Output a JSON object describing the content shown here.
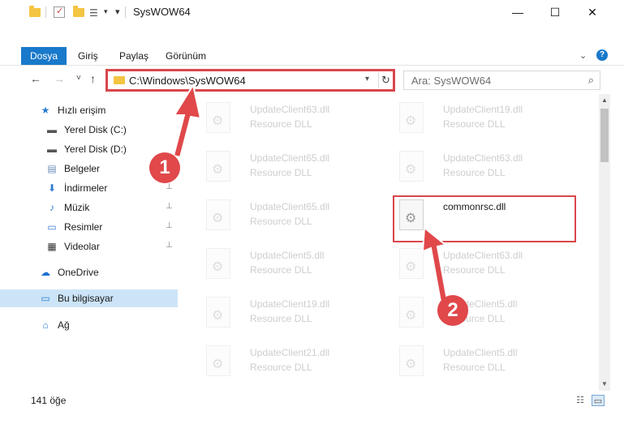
{
  "window": {
    "title": "SysWOW64",
    "controls": {
      "minimize": "—",
      "maximize": "☐",
      "close": "✕"
    }
  },
  "ribbon": {
    "tabs": [
      "Dosya",
      "Giriş",
      "Paylaş",
      "Görünüm"
    ],
    "collapse_icon": "chevron-up-icon",
    "help": "?"
  },
  "nav": {
    "back": "←",
    "forward": "→",
    "recent": "˅",
    "up": "↑",
    "address": "C:\\Windows\\SysWOW64",
    "refresh": "↻",
    "search_placeholder": "Ara: SysWOW64"
  },
  "sidebar": {
    "items": [
      {
        "label": "Hızlı erişim",
        "icon": "star-icon",
        "glyph": "★",
        "color": "#2b7cd3",
        "level": 0
      },
      {
        "label": "Yerel Disk (C:)",
        "icon": "drive-icon",
        "glyph": "▬",
        "color": "#555555",
        "level": 1,
        "pinned": true
      },
      {
        "label": "Yerel Disk (D:)",
        "icon": "drive-icon",
        "glyph": "▬",
        "color": "#555555",
        "level": 1,
        "pinned": true
      },
      {
        "label": "Belgeler",
        "icon": "documents-icon",
        "glyph": "▤",
        "color": "#6b8fb8",
        "level": 1,
        "pinned": true
      },
      {
        "label": "İndirmeler",
        "icon": "downloads-icon",
        "glyph": "⬇",
        "color": "#2b7cd3",
        "level": 1,
        "pinned": true
      },
      {
        "label": "Müzik",
        "icon": "music-icon",
        "glyph": "♪",
        "color": "#2b7cd3",
        "level": 1,
        "pinned": true
      },
      {
        "label": "Resimler",
        "icon": "pictures-icon",
        "glyph": "▭",
        "color": "#3a7bd5",
        "level": 1,
        "pinned": true
      },
      {
        "label": "Videolar",
        "icon": "videos-icon",
        "glyph": "▦",
        "color": "#333333",
        "level": 1,
        "pinned": true
      },
      {
        "label": "OneDrive",
        "icon": "cloud-icon",
        "glyph": "☁",
        "color": "#1e6fcf",
        "level": 0
      },
      {
        "label": "Bu bilgisayar",
        "icon": "computer-icon",
        "glyph": "▭",
        "color": "#2b7cd3",
        "level": 0,
        "selected": true
      },
      {
        "label": "Ağ",
        "icon": "network-icon",
        "glyph": "⌂",
        "color": "#2b7cd3",
        "level": 0
      }
    ],
    "pin_glyph": "📌"
  },
  "files": [
    {
      "name": "UpdateClient63.dll",
      "type": "Resource DLL",
      "faded": true
    },
    {
      "name": "UpdateClient19.dll",
      "type": "Resource DLL",
      "faded": true
    },
    {
      "name": "UpdateClient65.dll",
      "type": "Resource DLL",
      "faded": true
    },
    {
      "name": "UpdateClient63.dll",
      "type": "Resource DLL",
      "faded": true
    },
    {
      "name": "UpdateClient65.dll",
      "type": "Resource DLL",
      "faded": true
    },
    {
      "name": "commonrsc.dll",
      "type": "",
      "faded": false,
      "highlighted": true
    },
    {
      "name": "UpdateClient5.dll",
      "type": "Resource DLL",
      "faded": true
    },
    {
      "name": "UpdateClient63.dll",
      "type": "Resource DLL",
      "faded": true
    },
    {
      "name": "UpdateClient19.dll",
      "type": "Resource DLL",
      "faded": true
    },
    {
      "name": "UpdateClient5.dll",
      "type": "Resource DLL",
      "faded": true
    },
    {
      "name": "UpdateClient21.dll",
      "type": "Resource DLL",
      "faded": true
    },
    {
      "name": "UpdateClient5.dll",
      "type": "Resource DLL",
      "faded": true
    }
  ],
  "status": {
    "count_text": "141 öğe"
  },
  "callouts": [
    {
      "number": "1",
      "color": "#e0484a"
    },
    {
      "number": "2",
      "color": "#e0484a"
    }
  ]
}
